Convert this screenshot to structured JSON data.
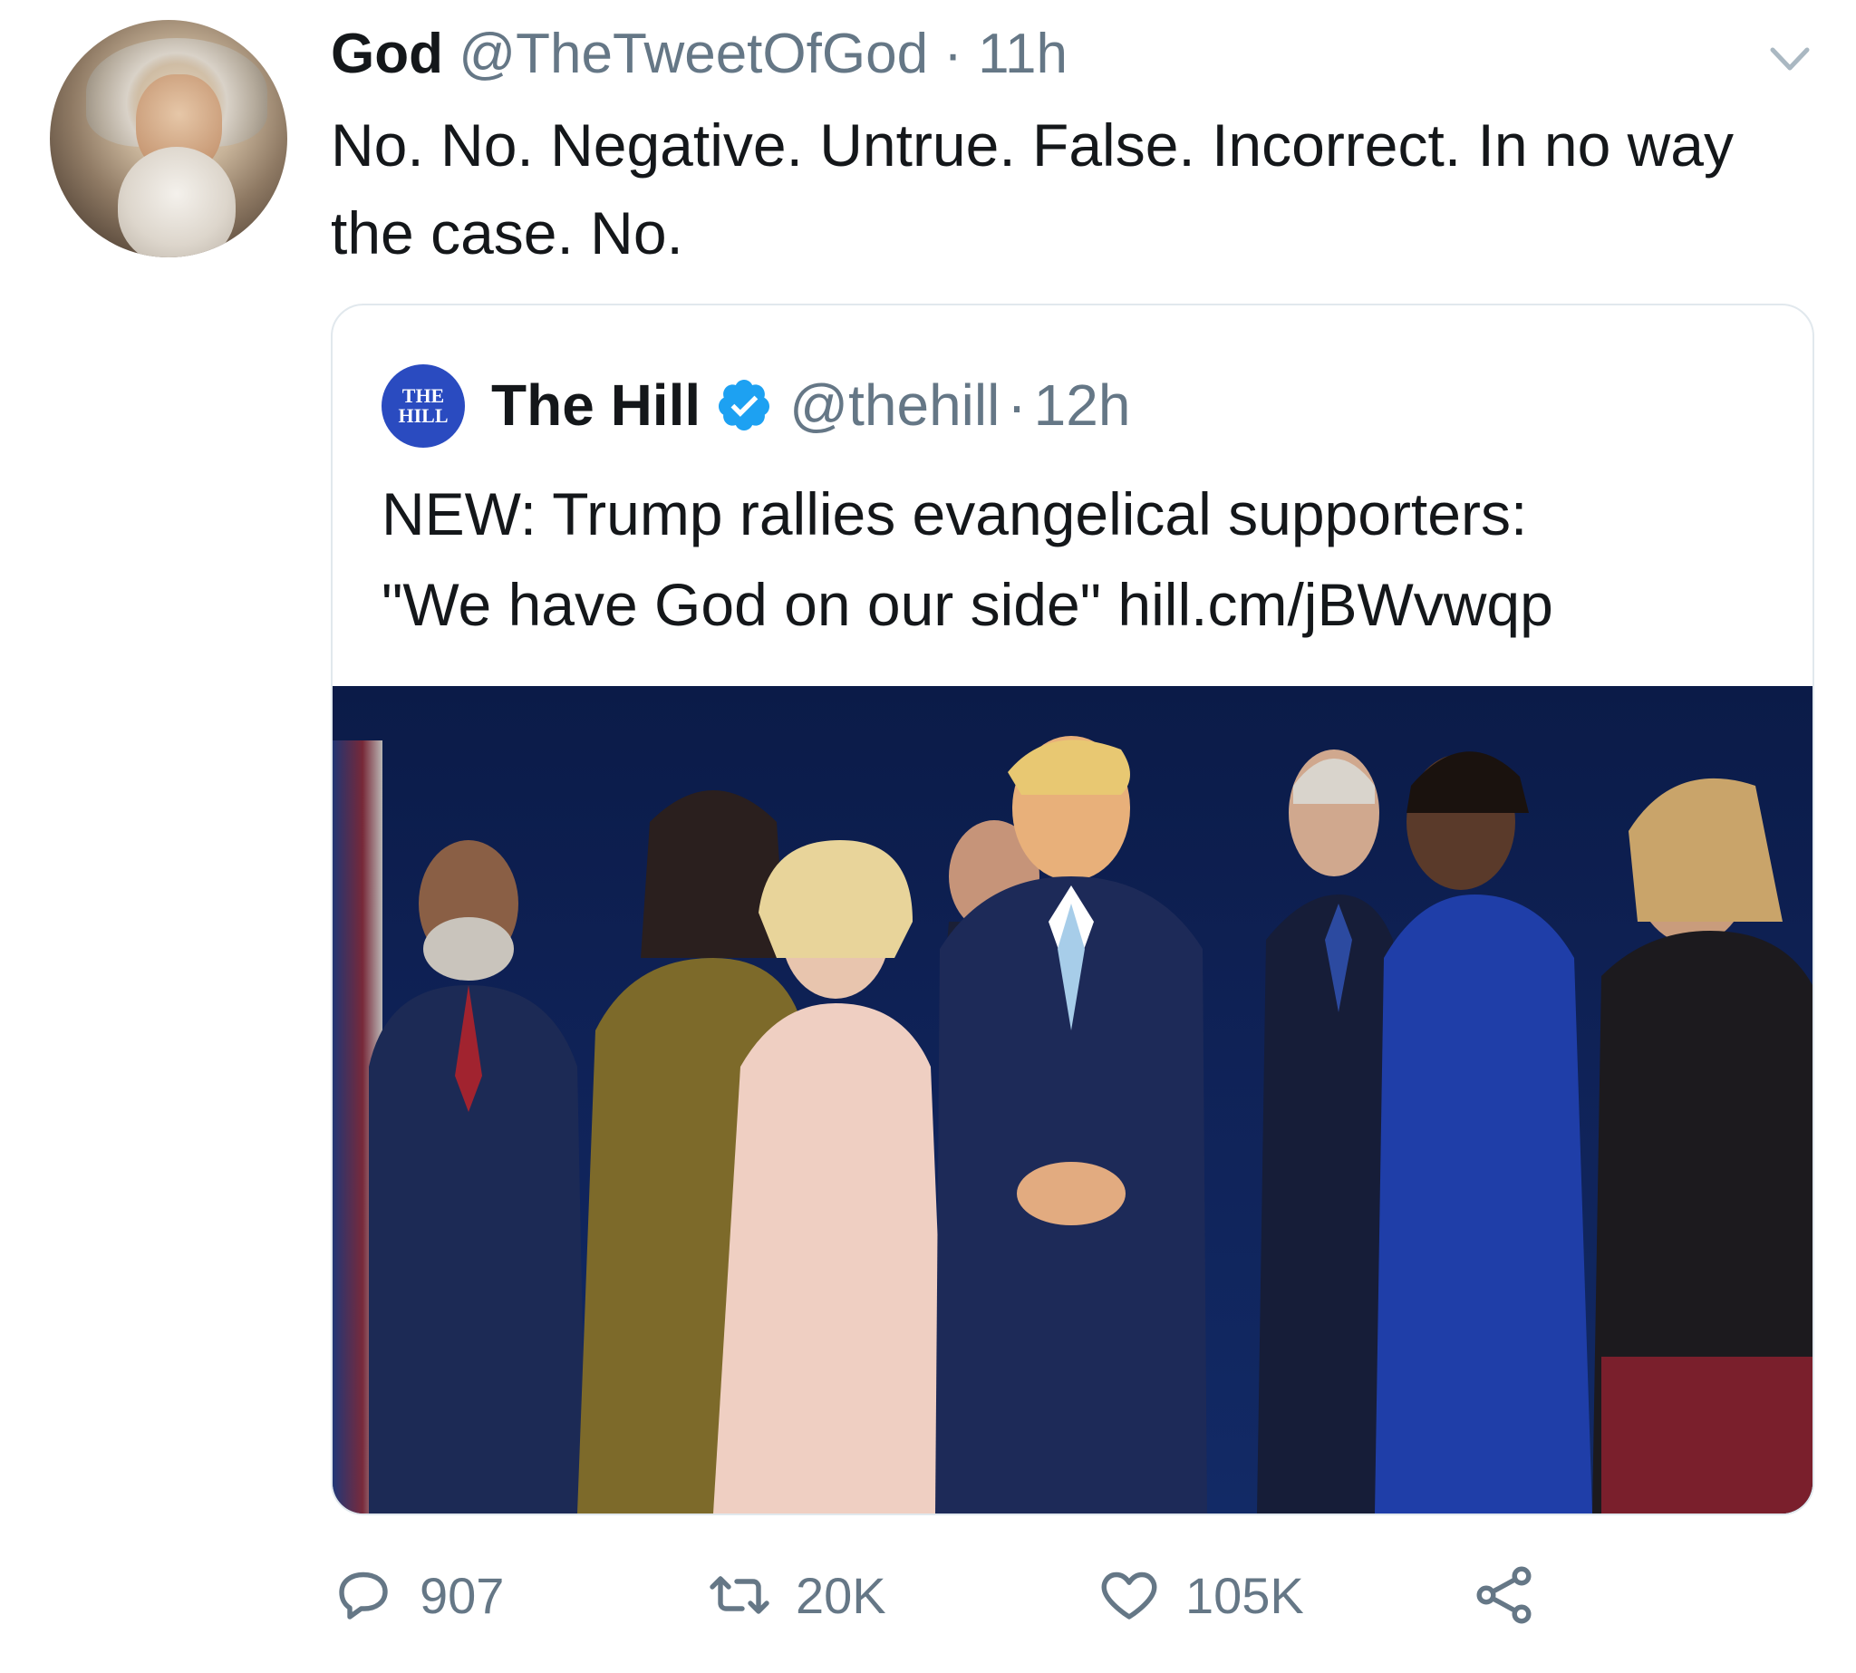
{
  "tweet": {
    "author_name": "God",
    "author_handle": "@TheTweetOfGod",
    "separator": "·",
    "time": "11h",
    "text": "No. No. Negative. Untrue. False. Incorrect. In no way the case. No."
  },
  "quoted_tweet": {
    "logo_line1": "THE",
    "logo_line2": "HILL",
    "author_name": "The Hill",
    "author_handle": "@thehill",
    "separator": "·",
    "time": "12h",
    "text_line1": "NEW: Trump rallies evangelical supporters:",
    "text_line2": "\"We have God on our side\" hill.cm/jBWvwqp"
  },
  "actions": {
    "reply_count": "907",
    "retweet_count": "20K",
    "like_count": "105K"
  },
  "icons": {
    "chevron": "chevron-down-icon",
    "verified": "verified-badge-icon",
    "reply": "reply-icon",
    "retweet": "retweet-icon",
    "like": "heart-icon",
    "share": "share-icon"
  },
  "colors": {
    "text": "#14171a",
    "muted": "#657786",
    "verified": "#1da1f2",
    "the_hill_logo": "#2a4bc0",
    "border": "#e1e8ed"
  }
}
